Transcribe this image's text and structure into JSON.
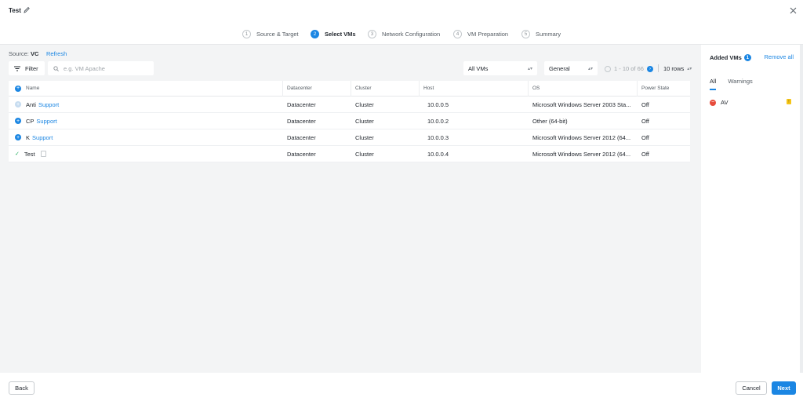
{
  "header": {
    "title": "Test"
  },
  "steps": [
    {
      "num": "1",
      "label": "Source & Target"
    },
    {
      "num": "2",
      "label": "Select VMs"
    },
    {
      "num": "3",
      "label": "Network Configuration"
    },
    {
      "num": "4",
      "label": "VM Preparation"
    },
    {
      "num": "5",
      "label": "Summary"
    }
  ],
  "active_step": 2,
  "source": {
    "label": "Source:",
    "value": "VC",
    "refresh": "Refresh"
  },
  "toolbar": {
    "filter_label": "Filter",
    "search_placeholder": "e.g. VM Apache",
    "vm_scope": "All VMs",
    "view": "General",
    "pagination": "1 - 10 of 66",
    "rows_per_page": "10 rows"
  },
  "table": {
    "headers": [
      "Name",
      "Datacenter",
      "Cluster",
      "Host",
      "OS",
      "Power State"
    ],
    "rows": [
      {
        "name": "Anti",
        "link": "Support",
        "datacenter": "Datacenter",
        "cluster": "Cluster",
        "host": "10.0.0.5",
        "os": "Microsoft Windows Server 2003 Sta...",
        "power": "Off"
      },
      {
        "name": "CP",
        "link": "Support",
        "datacenter": "Datacenter",
        "cluster": "Cluster",
        "host": "10.0.0.2",
        "os": "Other (64-bit)",
        "power": "Off"
      },
      {
        "name": "K",
        "link": "Support",
        "datacenter": "Datacenter",
        "cluster": "Cluster",
        "host": "10.0.0.3",
        "os": "Microsoft Windows Server 2012 (64...",
        "power": "Off"
      },
      {
        "name": "Test",
        "link": "",
        "datacenter": "Datacenter",
        "cluster": "Cluster",
        "host": "10.0.0.4",
        "os": "Microsoft Windows Server 2012 (64...",
        "power": "Off"
      }
    ]
  },
  "sidebar": {
    "title": "Added VMs",
    "count": "1",
    "remove_all": "Remove all",
    "tabs": [
      "All",
      "Warnings"
    ],
    "items": [
      {
        "name": "AV",
        "warning": "!"
      }
    ]
  },
  "footer": {
    "back": "Back",
    "cancel": "Cancel",
    "next": "Next"
  },
  "colors": {
    "accent": "#1b86e3",
    "remove": "#e74c3c",
    "warning": "#f5c518",
    "added": "#27ae60"
  }
}
